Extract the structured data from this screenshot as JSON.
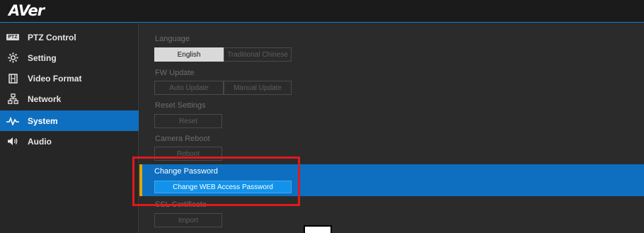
{
  "header": {
    "logo": "AVer"
  },
  "sidebar": {
    "items": [
      {
        "label": "PTZ Control",
        "icon": "ptz-icon",
        "badge": "PTZ",
        "active": false
      },
      {
        "label": "Setting",
        "icon": "gear-icon",
        "active": false
      },
      {
        "label": "Video Format",
        "icon": "film-icon",
        "active": false
      },
      {
        "label": "Network",
        "icon": "network-icon",
        "active": false
      },
      {
        "label": "System",
        "icon": "pulse-icon",
        "active": true
      },
      {
        "label": "Audio",
        "icon": "speaker-icon",
        "active": false
      }
    ]
  },
  "main": {
    "language": {
      "label": "Language",
      "options": [
        "English",
        "Traditional Chinese"
      ],
      "selected": "English"
    },
    "fw_update": {
      "label": "FW Update",
      "buttons": [
        "Auto Update",
        "Manual Update"
      ]
    },
    "reset": {
      "label": "Reset Settings",
      "button": "Reset"
    },
    "reboot": {
      "label": "Camera Reboot",
      "button": "Reboot"
    },
    "password": {
      "label": "Change Password",
      "button": "Change WEB Access Password"
    },
    "ssl": {
      "label": "SSL Certificate",
      "button": "Import"
    }
  },
  "colors": {
    "accent": "#0e6fc0",
    "button_blue": "#1292ea",
    "highlight": "#e0191d",
    "marker": "#e0a800"
  }
}
